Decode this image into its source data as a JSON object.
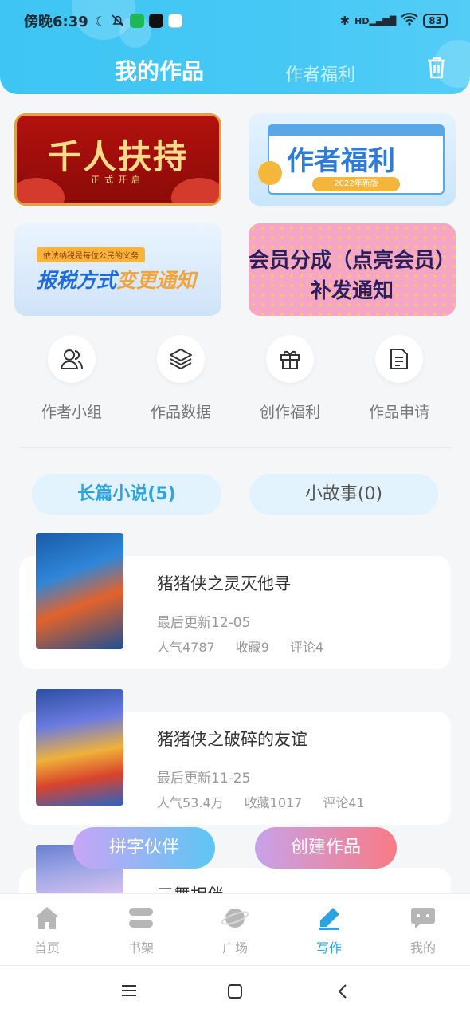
{
  "status_bar": {
    "time": "傍晚6:39",
    "battery": "83",
    "network_label": "HD"
  },
  "header": {
    "tab_active": "我的作品",
    "tab_other": "作者福利"
  },
  "banners": [
    {
      "title": "千人扶持",
      "subtitle": "正式开启"
    },
    {
      "title": "作者福利",
      "subtitle": "2022年新版"
    },
    {
      "tag": "依法纳税是每位公民的义务",
      "title_a": "报税方式",
      "title_b": "变更通知"
    },
    {
      "title": "会员分成（点亮会员）补发通知"
    }
  ],
  "quick_links": [
    {
      "label": "作者小组",
      "icon": "group-icon"
    },
    {
      "label": "作品数据",
      "icon": "layers-icon"
    },
    {
      "label": "创作福利",
      "icon": "gift-icon"
    },
    {
      "label": "作品申请",
      "icon": "document-icon"
    }
  ],
  "segments": {
    "long": "长篇小说(5)",
    "short": "小故事(0)"
  },
  "books": [
    {
      "title": "猪猪侠之灵灭他寻",
      "updated": "最后更新12-05",
      "popularity": "人气4787",
      "favorites": "收藏9",
      "comments": "评论4"
    },
    {
      "title": "猪猪侠之破碎的友谊",
      "updated": "最后更新11-25",
      "popularity": "人气53.4万",
      "favorites": "收藏1017",
      "comments": "评论41"
    },
    {
      "title": "三舞相伴"
    }
  ],
  "actions": {
    "partner": "拼字伙伴",
    "create": "创建作品"
  },
  "nav": [
    {
      "label": "首页",
      "icon": "home-icon"
    },
    {
      "label": "书架",
      "icon": "bookshelf-icon"
    },
    {
      "label": "广场",
      "icon": "planet-icon"
    },
    {
      "label": "写作",
      "icon": "pen-icon"
    },
    {
      "label": "我的",
      "icon": "chat-icon"
    }
  ],
  "colors": {
    "accent": "#2ca4e0",
    "header": "#46c8f5"
  }
}
